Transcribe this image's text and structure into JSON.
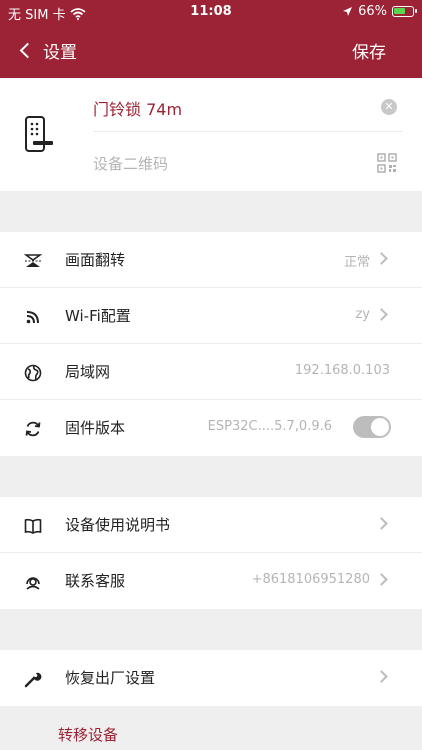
{
  "status_bar": {
    "carrier": "无 SIM 卡",
    "time": "11:08",
    "battery": "66%",
    "battery_level": 0.66
  },
  "nav": {
    "back_label": "设置",
    "save_label": "保存"
  },
  "device": {
    "name": "门铃锁 74m",
    "qr_placeholder": "设备二维码"
  },
  "settings": [
    {
      "label": "画面翻转",
      "value": "正常",
      "icon": "flip-icon"
    },
    {
      "label": "Wi-Fi配置",
      "value": "zy",
      "icon": "wifi-icon"
    },
    {
      "label": "局域网",
      "value": "192.168.0.103",
      "icon": "globe-icon"
    },
    {
      "label": "固件版本",
      "value": "ESP32C....5.7,0.9.6",
      "icon": "refresh-icon"
    }
  ],
  "support": [
    {
      "label": "设备使用说明书",
      "value": "",
      "icon": "book-icon"
    },
    {
      "label": "联系客服",
      "value": "+8618106951280",
      "icon": "headset-icon"
    }
  ],
  "reset": {
    "label": "恢复出厂设置",
    "icon": "wrench-icon"
  },
  "transfer_label": "转移设备",
  "colors": {
    "brand": "#9b2335",
    "background": "#efefef"
  }
}
